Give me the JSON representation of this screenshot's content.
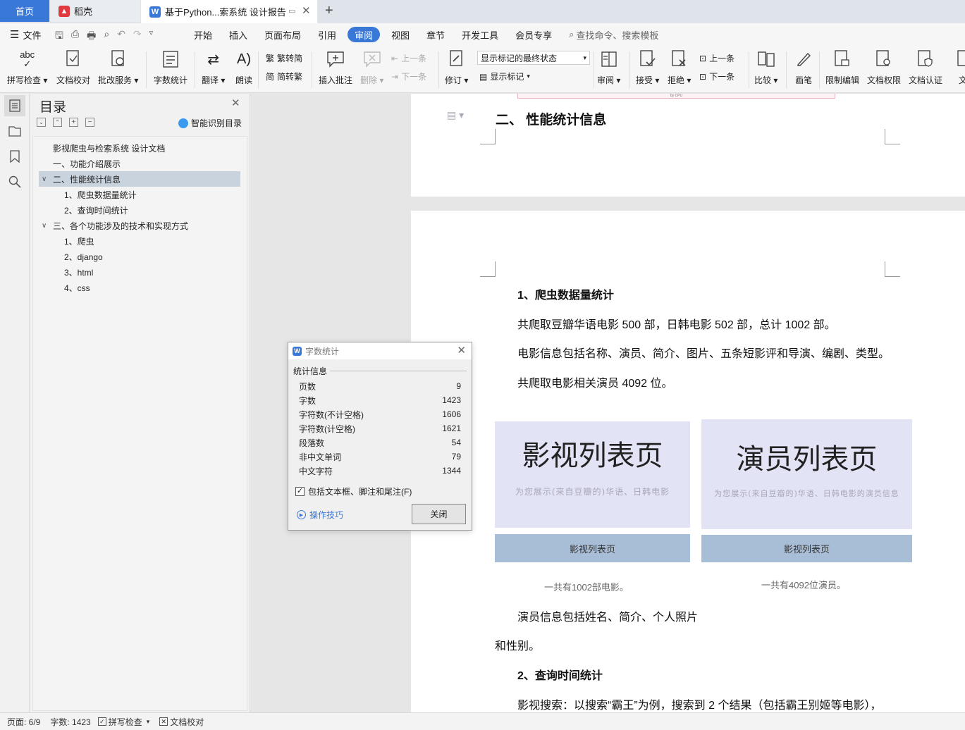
{
  "tabs": {
    "home": "首页",
    "daoke": "稻壳",
    "doc": "基于Python...索系统 设计报告"
  },
  "menu": {
    "file": "文件",
    "items": [
      "开始",
      "插入",
      "页面布局",
      "引用",
      "审阅",
      "视图",
      "章节",
      "开发工具",
      "会员专享"
    ],
    "active": "审阅",
    "search": "查找命令、搜索模板"
  },
  "ribbon": {
    "spellcheck": "拼写检查",
    "doc_proof": "文档校对",
    "review_service": "批改服务",
    "word_count": "字数统计",
    "translate": "翻译",
    "read_aloud": "朗读",
    "to_traditional": "繁转简",
    "to_simplified": "简转繁",
    "insert_comment": "插入批注",
    "delete": "删除",
    "prev_comment": "上一条",
    "next_comment": "下一条",
    "track_changes": "修订",
    "markup_state": "显示标记的最终状态",
    "show_markup": "显示标记",
    "review": "审阅",
    "accept": "接受",
    "reject": "拒绝",
    "prev_change": "上一条",
    "next_change": "下一条",
    "compare": "比较",
    "ink": "画笔",
    "restrict_edit": "限制编辑",
    "doc_permission": "文档权限",
    "doc_auth": "文档认证",
    "more": "文"
  },
  "toc": {
    "title": "目录",
    "smart_toc": "智能识别目录",
    "items": [
      {
        "text": "影视爬虫与检索系统  设计文档",
        "level": 0,
        "arrow": ""
      },
      {
        "text": "一、功能介绍展示",
        "level": 0,
        "arrow": ""
      },
      {
        "text": "二、性能统计信息",
        "level": 0,
        "arrow": "v",
        "selected": true
      },
      {
        "text": "1、爬虫数据量统计",
        "level": 1,
        "arrow": ""
      },
      {
        "text": "2、查询时间统计",
        "level": 1,
        "arrow": ""
      },
      {
        "text": "三、各个功能涉及的技术和实现方式",
        "level": 0,
        "arrow": "v"
      },
      {
        "text": "1、爬虫",
        "level": 1,
        "arrow": ""
      },
      {
        "text": "2、django",
        "level": 1,
        "arrow": ""
      },
      {
        "text": "3、html",
        "level": 1,
        "arrow": ""
      },
      {
        "text": "4、css",
        "level": 1,
        "arrow": ""
      }
    ]
  },
  "doc": {
    "top_strip": "by CPU",
    "heading2": "二、    性能统计信息",
    "sub1": "1、爬虫数据量统计",
    "para1": "共爬取豆瓣华语电影 500 部，日韩电影 502 部，总计 1002 部。",
    "para2": "电影信息包括名称、演员、简介、图片、五条短影评和导演、编剧、类型。",
    "para3": "共爬取电影相关演员 4092 位。",
    "card_left": {
      "big": "影视列表页",
      "sub": "为您展示(来自豆瓣的)华语、日韩电影",
      "button": "影视列表页",
      "caption": "一共有1002部电影。"
    },
    "card_right": {
      "big": "演员列表页",
      "sub": "为您展示(来自豆瓣的)华语、日韩电影的演员信息",
      "button": "影视列表页",
      "caption": "一共有4092位演员。"
    },
    "para4": "演员信息包括姓名、简介、个人照片",
    "para5": "和性别。",
    "sub2": "2、查询时间统计",
    "para6": "影视搜索：以搜索“霸王”为例，搜索到 2 个结果（包括霸王别姬等电影），"
  },
  "dialog": {
    "title": "字数统计",
    "group": "统计信息",
    "rows": [
      {
        "label": "页数",
        "value": "9"
      },
      {
        "label": "字数",
        "value": "1423"
      },
      {
        "label": "字符数(不计空格)",
        "value": "1606"
      },
      {
        "label": "字符数(计空格)",
        "value": "1621"
      },
      {
        "label": "段落数",
        "value": "54"
      },
      {
        "label": "非中文单词",
        "value": "79"
      },
      {
        "label": "中文字符",
        "value": "1344"
      }
    ],
    "checkbox": "包括文本框、脚注和尾注(F)",
    "tips": "操作技巧",
    "close": "关闭"
  },
  "status": {
    "page": "页面: 6/9",
    "words": "字数: 1423",
    "spell": "拼写检查",
    "proof": "文档校对"
  },
  "colors": {
    "accent": "#3a78d8",
    "card_bg": "#e3e3f6",
    "card_btn": "#a8bdd6"
  }
}
